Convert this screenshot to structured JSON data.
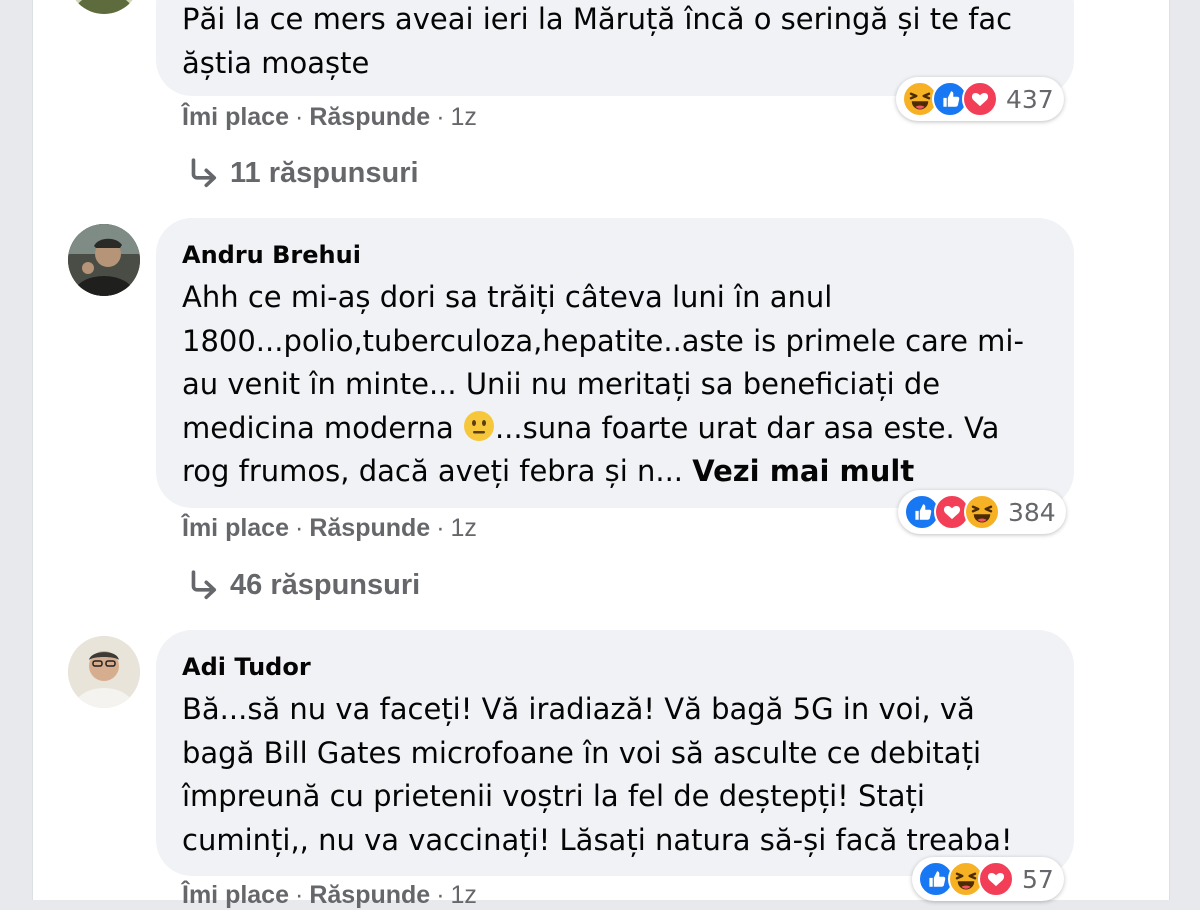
{
  "colors": {
    "like": "#1877f2",
    "love": "#f33e58",
    "haha": "#f7b125",
    "bubble": "#f0f2f5",
    "meta_text": "#65676b"
  },
  "comments": [
    {
      "author": "",
      "lines": [
        "Păi la ce mers aveai ieri la Măruță încă o seringă și te fac",
        "ăștia moaște"
      ],
      "like_label": "Îmi place",
      "reply_label": "Răspunde",
      "time": "1z",
      "reaction_icons": [
        "haha",
        "like",
        "love"
      ],
      "reaction_count": "437",
      "replies_label": "11 răspunsuri"
    },
    {
      "author": "Andru Brehui",
      "lines": [
        "Ahh ce mi-aș dori sa trăiți câteva luni în anul",
        "1800...polio,tuberculoza,hepatite..aste is primele care mi-",
        "au venit în minte... Unii nu meritați sa beneficiați de",
        "medicina moderna",
        "...suna foarte urat dar asa este. Va",
        "rog frumos, dacă aveți febra și n..."
      ],
      "see_more": "Vezi mai mult",
      "inline_emoji": "neutral-face-icon",
      "like_label": "Îmi place",
      "reply_label": "Răspunde",
      "time": "1z",
      "reaction_icons": [
        "like",
        "love",
        "haha"
      ],
      "reaction_count": "384",
      "replies_label": "46 răspunsuri"
    },
    {
      "author": "Adi Tudor",
      "lines": [
        "Bă...să nu va faceți! Vă iradiază! Vă bagă 5G in voi, vă",
        "bagă Bill Gates microfoane în voi să asculte ce debitați",
        "împreună cu prietenii voștri la fel de deștepți! Stați",
        "cuminți,, nu va vaccinați! Lăsați natura să-și facă treaba!"
      ],
      "like_label": "Îmi place",
      "reply_label": "Răspunde",
      "time": "1z",
      "reaction_icons": [
        "like",
        "haha",
        "love"
      ],
      "reaction_count": "57"
    }
  ]
}
